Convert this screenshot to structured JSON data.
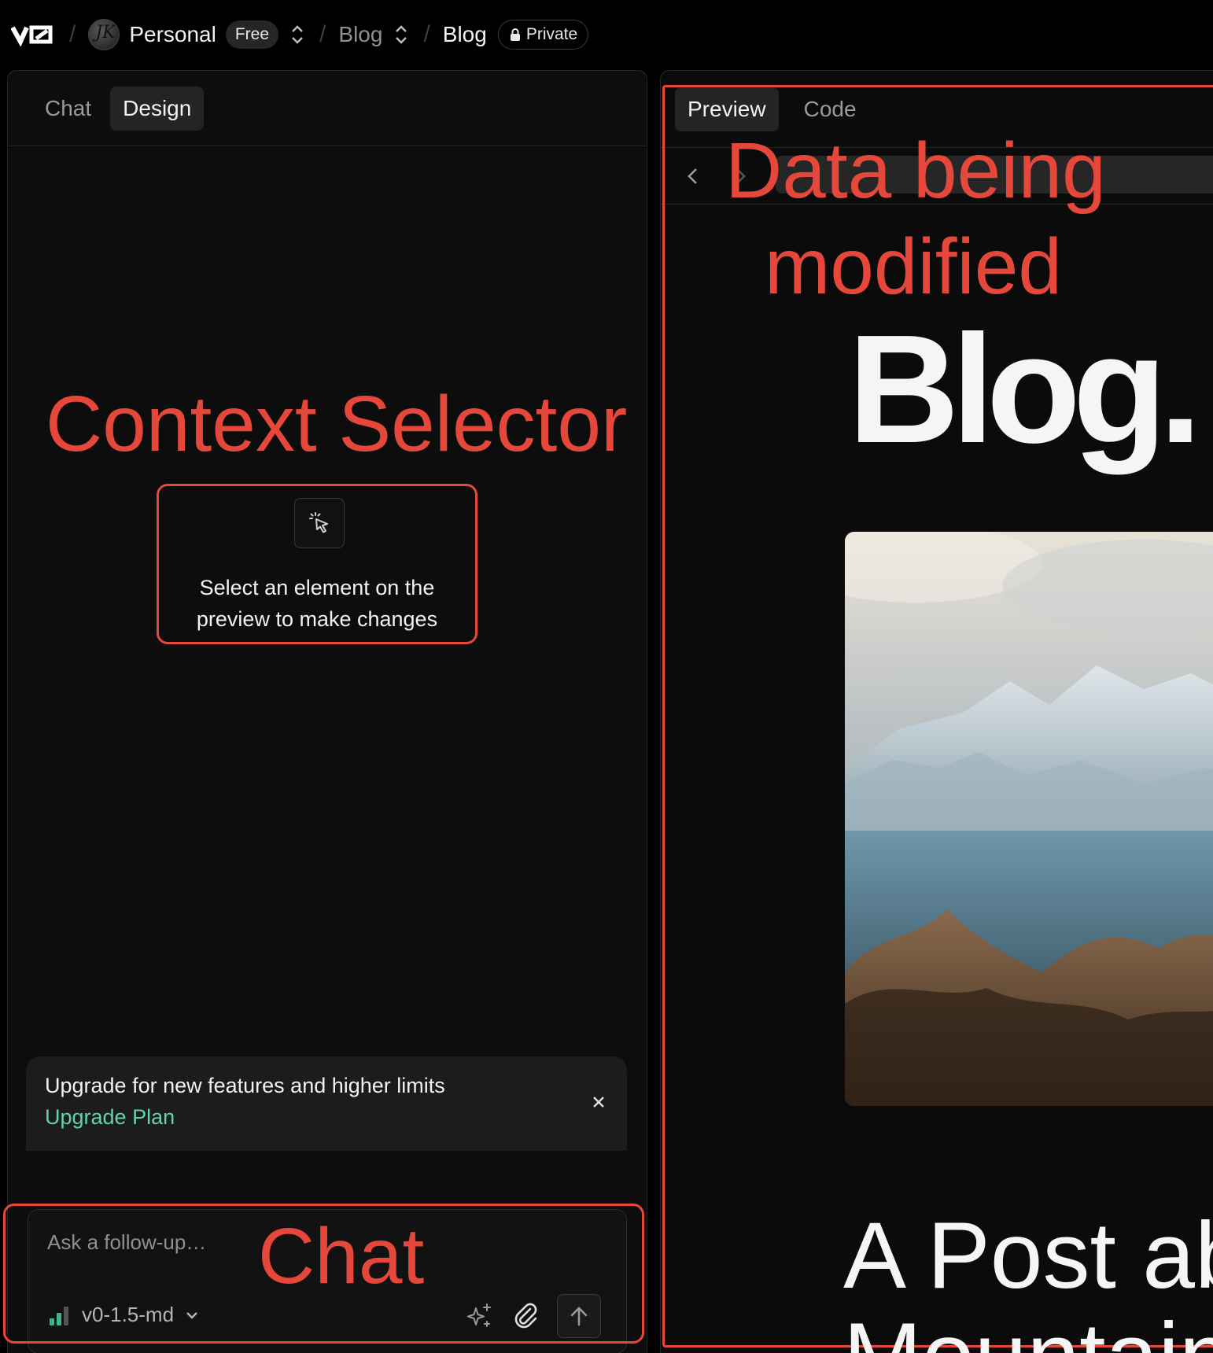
{
  "topbar": {
    "logo": "v0",
    "avatar_initials": "JK",
    "workspace": "Personal",
    "plan_badge": "Free",
    "project": "Blog",
    "chat_name": "Blog",
    "visibility": "Private"
  },
  "left_panel": {
    "tabs": [
      {
        "label": "Chat",
        "active": false
      },
      {
        "label": "Design",
        "active": true
      }
    ],
    "context_selector": {
      "annotation": "Context Selector",
      "message": "Select an element on the preview to make changes"
    },
    "upgrade_banner": {
      "text": "Upgrade for new features and higher limits",
      "link": "Upgrade Plan"
    },
    "chat": {
      "annotation": "Chat",
      "placeholder": "Ask a follow-up…",
      "model": "v0-1.5-md"
    }
  },
  "right_panel": {
    "tabs": [
      {
        "label": "Preview",
        "active": true
      },
      {
        "label": "Code",
        "active": false
      }
    ],
    "annotation": "Data being modified",
    "annotation_line1": "Data being",
    "annotation_line2": "modified",
    "preview": {
      "blog_title": "Blog.",
      "post_title_line1": "A Post ab",
      "post_title_line2": "Mountain"
    }
  },
  "colors": {
    "annotation": "#e5483a",
    "link": "#5fd3b3",
    "background": "#000000",
    "panel": "#0d0d0d"
  }
}
